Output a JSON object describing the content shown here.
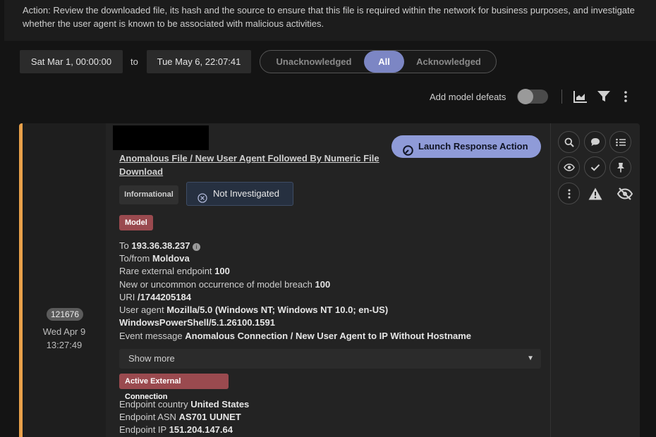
{
  "top": {
    "action_text": "Action: Review the downloaded file, its hash and the source to ensure that this file is required within the network for business purposes, and investigate whether the user agent is known to be associated with malicious activities."
  },
  "filters": {
    "date_from": "Sat Mar 1, 00:00:00",
    "to_label": "to",
    "date_to": "Tue May 6, 22:07:41",
    "tabs": [
      "Unacknowledged",
      "All",
      "Acknowledged"
    ],
    "active_tab": "All"
  },
  "toolbar": {
    "add_model_defeats_label": "Add model defeats",
    "add_model_defeats_enabled": false
  },
  "card": {
    "id": "121676",
    "date": "Wed Apr 9",
    "time": "13:27:49",
    "accent_color": "#e8a04a",
    "title": "Anomalous File / New User Agent Followed By Numeric File Download",
    "severity_badge": "Informational",
    "status_badge": "Not Investigated",
    "launch_button": "Launch Response Action",
    "model_tag": "Model",
    "details": [
      {
        "label": "To",
        "value": "193.36.38.237"
      },
      {
        "label": "To/from",
        "value": "Moldova"
      },
      {
        "label": "Rare external endpoint",
        "value": "100"
      },
      {
        "label": "New or uncommon occurrence of model breach",
        "value": "100"
      },
      {
        "label": "URI",
        "value": "/1744205184"
      },
      {
        "label": "User agent",
        "value": "Mozilla/5.0 (Windows NT; Windows NT 10.0; en-US)"
      },
      {
        "label": "",
        "value": "WindowsPowerShell/5.1.26100.1591"
      },
      {
        "label": "Event message",
        "value": "Anomalous Connection / New User Agent to IP Without Hostname"
      }
    ],
    "show_more": "Show more",
    "connection_tag": "Active External Connection",
    "connection_details": [
      {
        "label": "Endpoint country",
        "value": "United States"
      },
      {
        "label": "Endpoint ASN",
        "value": "AS701 UUNET"
      },
      {
        "label": "Endpoint IP",
        "value": "151.204.147.64"
      }
    ],
    "side_icons": [
      "search-icon",
      "comment-icon",
      "list-icon",
      "eye-icon",
      "check-icon",
      "pin-icon",
      "more-vertical-icon",
      "warning-icon",
      "hide-icon"
    ]
  }
}
